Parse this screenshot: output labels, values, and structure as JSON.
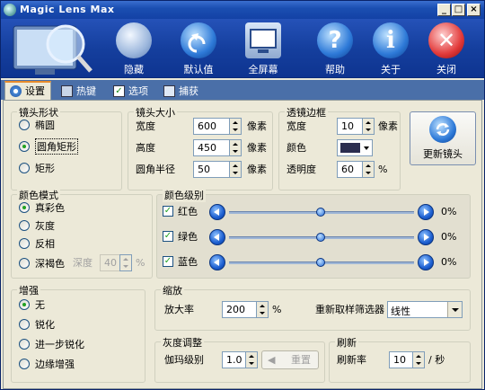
{
  "window": {
    "title": "Magic Lens Max"
  },
  "toolbar": {
    "hide": "隐藏",
    "defaults": "默认值",
    "fullscreen": "全屏幕",
    "help": "帮助",
    "about": "关于",
    "close": "关闭"
  },
  "tabs": [
    "设置",
    "热键",
    "选项",
    "捕获"
  ],
  "lens_shape": {
    "label": "镜头形状",
    "options": [
      "椭圆",
      "圆角矩形",
      "矩形"
    ],
    "selected": "圆角矩形"
  },
  "lens_size": {
    "label": "镜头大小",
    "width_label": "宽度",
    "width_value": "600",
    "height_label": "高度",
    "height_value": "450",
    "radius_label": "圆角半径",
    "radius_value": "50",
    "unit": "像素"
  },
  "lens_border": {
    "label": "透镜边框",
    "width_label": "宽度",
    "width_value": "10",
    "width_unit": "像素",
    "color_label": "颜色",
    "color_value": "#2b2d4f",
    "opacity_label": "透明度",
    "opacity_value": "60",
    "opacity_unit": "%"
  },
  "refresh_lens": {
    "label": "更新镜头"
  },
  "color_mode": {
    "label": "颜色模式",
    "options": [
      "真彩色",
      "灰度",
      "反相",
      "深褐色"
    ],
    "selected": "真彩色",
    "depth_label": "深度",
    "depth_value": "40",
    "depth_unit": "%"
  },
  "color_level": {
    "label": "颜色级别",
    "channels": [
      {
        "label": "红色",
        "checked": true,
        "value": "0%",
        "level": 0.0
      },
      {
        "label": "绿色",
        "checked": true,
        "value": "0%",
        "level": 0.0
      },
      {
        "label": "蓝色",
        "checked": true,
        "value": "0%",
        "level": 0.0
      }
    ]
  },
  "enhance": {
    "label": "增强",
    "options": [
      "无",
      "锐化",
      "进一步锐化",
      "边缘增强"
    ],
    "selected": "无"
  },
  "zoom": {
    "label": "缩放",
    "ratio_label": "放大率",
    "ratio_value": "200",
    "ratio_unit": "%",
    "resample_label": "重新取样筛选器",
    "resample_value": "线性"
  },
  "gray_adjust": {
    "label": "灰度调整",
    "gamma_label": "伽玛级别",
    "gamma_value": "1.0",
    "reset_label": "重置"
  },
  "refresh": {
    "label": "刷新",
    "rate_label": "刷新率",
    "rate_value": "10",
    "rate_unit": "/ 秒"
  }
}
